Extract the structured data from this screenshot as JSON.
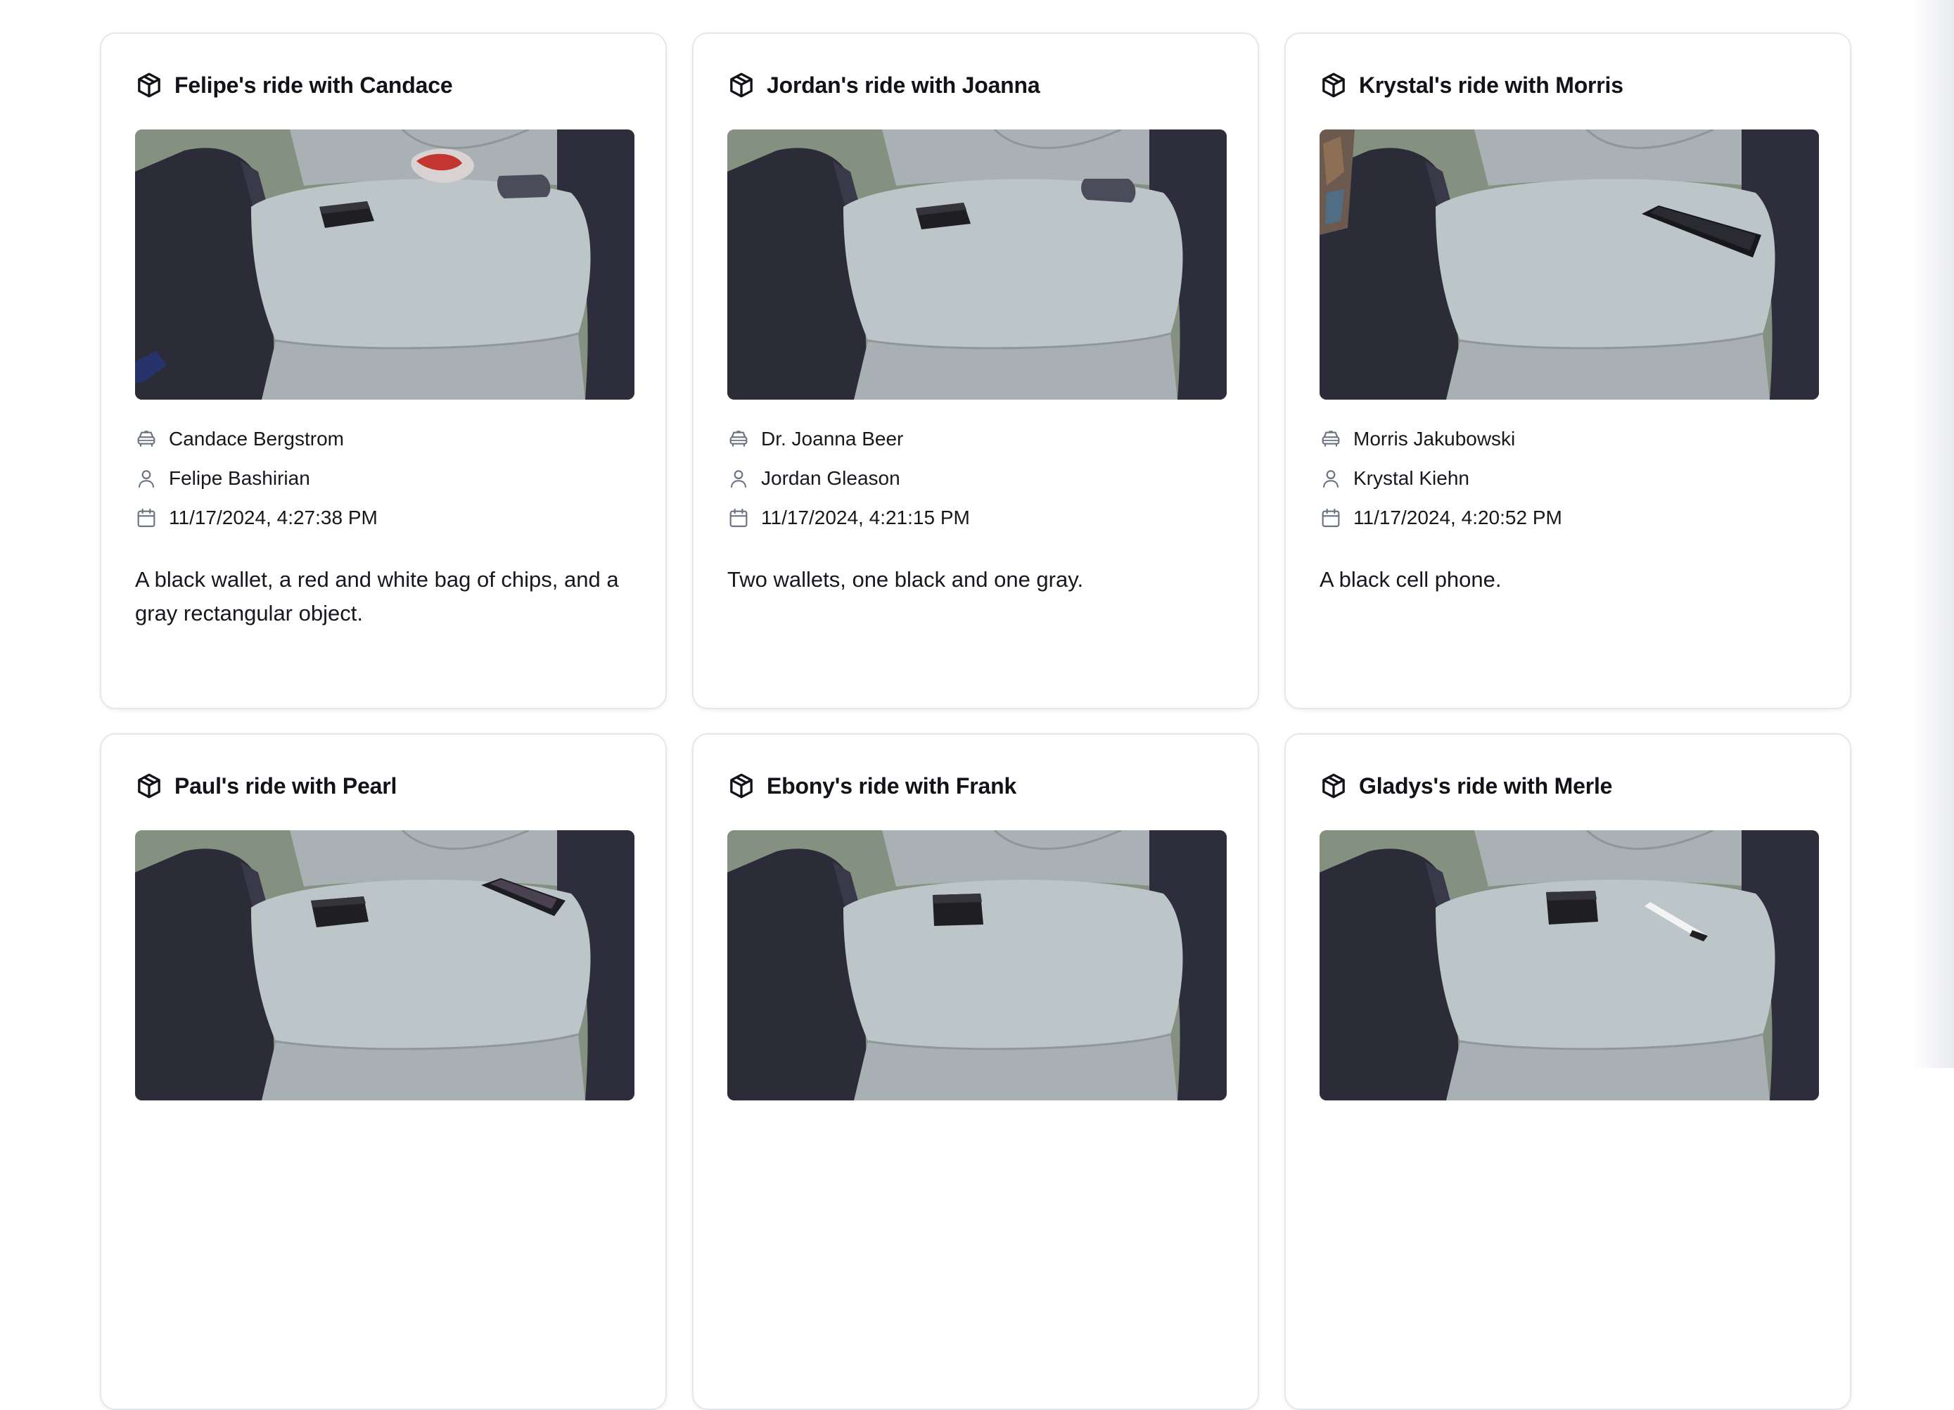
{
  "rides": [
    {
      "title": "Felipe's ride with Candace",
      "driver": "Candace Bergstrom",
      "rider": "Felipe Bashirian",
      "datetime": "11/17/2024, 4:27:38 PM",
      "description": "A black wallet, a red and white bag of chips, and a gray rectangular object."
    },
    {
      "title": "Jordan's ride with Joanna",
      "driver": "Dr. Joanna Beer",
      "rider": "Jordan Gleason",
      "datetime": "11/17/2024, 4:21:15 PM",
      "description": "Two wallets, one black and one gray."
    },
    {
      "title": "Krystal's ride with Morris",
      "driver": "Morris Jakubowski",
      "rider": "Krystal Kiehn",
      "datetime": "11/17/2024, 4:20:52 PM",
      "description": "A black cell phone."
    },
    {
      "title": "Paul's ride with Pearl"
    },
    {
      "title": "Ebony's ride with Frank"
    },
    {
      "title": "Gladys's ride with Merle"
    }
  ],
  "icons": {
    "card_title": "package-icon",
    "driver": "car-icon",
    "rider": "user-icon",
    "datetime": "calendar-icon"
  },
  "colors": {
    "card_border": "#e5e7eb",
    "text": "#111318",
    "icon_stroke": "#6b7280",
    "seat": "#b8c2c4",
    "armrest": "#2b2b36",
    "carpet": "#7d8a78"
  }
}
